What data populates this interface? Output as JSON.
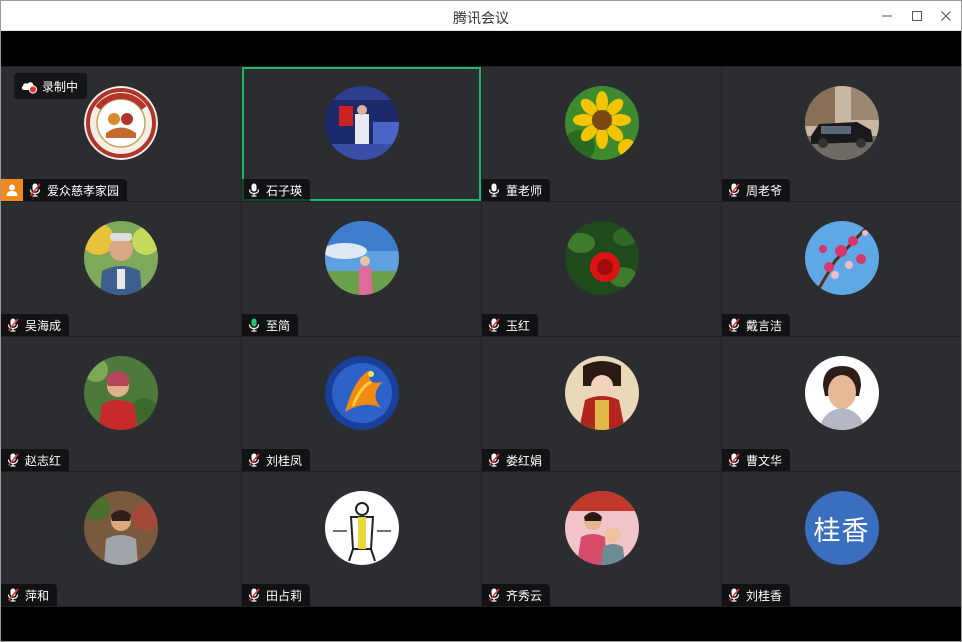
{
  "window": {
    "title": "腾讯会议"
  },
  "recording": {
    "label": "录制中",
    "icon": "cloud-recording-icon"
  },
  "colors": {
    "active_border": "#1fb86a",
    "host_badge": "#f08a1d",
    "tile_bg": "#2c2d31",
    "mic_active": "#25c16f",
    "mic_muted": "#e23b3b"
  },
  "participants": [
    {
      "name": "爱众慈孝家园",
      "mic": "muted",
      "host": true,
      "active": false,
      "avatar": "logo"
    },
    {
      "name": "石子瑛",
      "mic": "on",
      "host": false,
      "active": true,
      "avatar": "photo-stage"
    },
    {
      "name": "董老师",
      "mic": "on",
      "host": false,
      "active": false,
      "avatar": "photo-sunflower"
    },
    {
      "name": "周老爷",
      "mic": "muted",
      "host": false,
      "active": false,
      "avatar": "photo-car"
    },
    {
      "name": "吴海成",
      "mic": "muted",
      "host": false,
      "active": false,
      "avatar": "photo-man"
    },
    {
      "name": "至简",
      "mic": "speaking",
      "host": false,
      "active": false,
      "avatar": "photo-sky"
    },
    {
      "name": "玉红",
      "mic": "muted",
      "host": false,
      "active": false,
      "avatar": "photo-rose"
    },
    {
      "name": "戴言洁",
      "mic": "muted",
      "host": false,
      "active": false,
      "avatar": "photo-blossom"
    },
    {
      "name": "赵志红",
      "mic": "muted",
      "host": false,
      "active": false,
      "avatar": "photo-woman-red"
    },
    {
      "name": "刘桂凤",
      "mic": "muted",
      "host": false,
      "active": false,
      "avatar": "photo-phoenix"
    },
    {
      "name": "娄红娟",
      "mic": "muted",
      "host": false,
      "active": false,
      "avatar": "photo-costume"
    },
    {
      "name": "曹文华",
      "mic": "muted",
      "host": false,
      "active": false,
      "avatar": "photo-portrait"
    },
    {
      "name": "萍和",
      "mic": "muted",
      "host": false,
      "active": false,
      "avatar": "photo-woman-garden"
    },
    {
      "name": "田占莉",
      "mic": "muted",
      "host": false,
      "active": false,
      "avatar": "photo-calligraphy"
    },
    {
      "name": "齐秀云",
      "mic": "muted",
      "host": false,
      "active": false,
      "avatar": "photo-family"
    },
    {
      "name": "刘桂香",
      "mic": "muted",
      "host": false,
      "active": false,
      "avatar": "text",
      "avatar_text": "桂香",
      "avatar_color": "#3a6fbf"
    }
  ]
}
